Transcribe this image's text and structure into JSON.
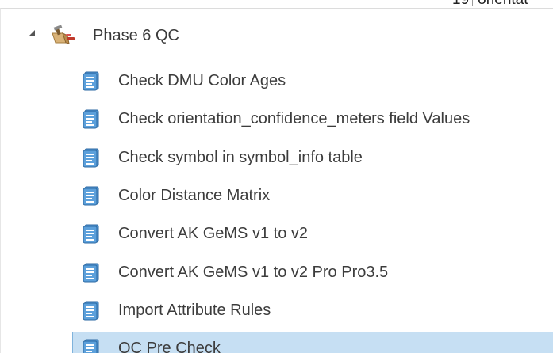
{
  "background_peek": {
    "number": "19",
    "text": "orientat"
  },
  "tree": {
    "parent": {
      "label": "Phase 6 QC",
      "expanded": true,
      "icon": "toolbox-icon"
    },
    "items": [
      {
        "label": "Check DMU Color Ages",
        "icon": "python-script-icon",
        "selected": false
      },
      {
        "label": "Check orientation_confidence_meters field Values",
        "icon": "python-script-icon",
        "selected": false
      },
      {
        "label": "Check symbol in symbol_info table",
        "icon": "python-script-icon",
        "selected": false
      },
      {
        "label": "Color Distance Matrix",
        "icon": "python-script-icon",
        "selected": false
      },
      {
        "label": "Convert AK GeMS v1 to v2",
        "icon": "python-script-icon",
        "selected": false
      },
      {
        "label": "Convert AK GeMS v1 to v2 Pro Pro3.5",
        "icon": "python-script-icon",
        "selected": false
      },
      {
        "label": "Import Attribute Rules",
        "icon": "python-script-icon",
        "selected": false
      },
      {
        "label": "QC Pre Check",
        "icon": "python-script-icon",
        "selected": true
      }
    ]
  },
  "colors": {
    "selection_fill": "#c6dff3",
    "selection_border": "#7fb3dc",
    "script_icon_blue": "#3f86c6",
    "toolbox_red": "#c0392b",
    "toolbox_tan": "#c9a36b"
  }
}
